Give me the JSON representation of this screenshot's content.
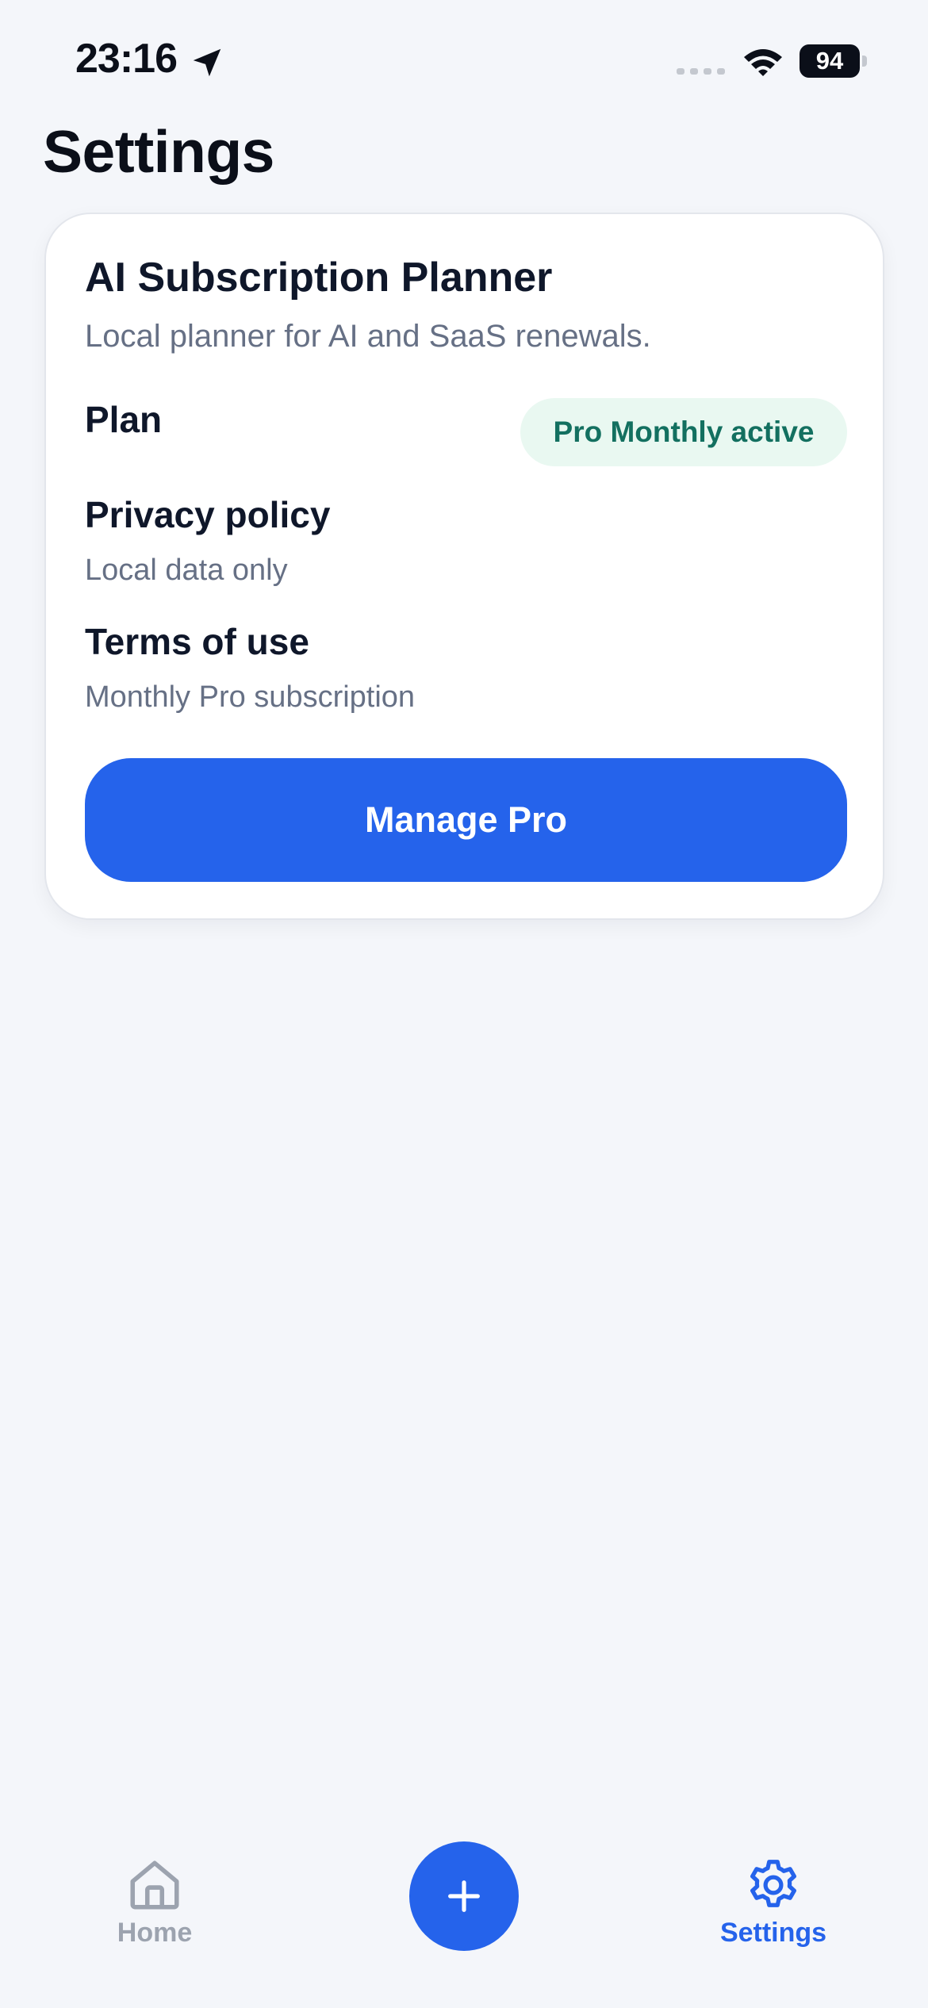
{
  "status_bar": {
    "time": "23:16",
    "battery": "94",
    "icons": [
      "location-arrow-icon",
      "cellular-signal-icon",
      "wifi-icon",
      "battery-icon"
    ]
  },
  "page": {
    "title": "Settings"
  },
  "card": {
    "app_name": "AI Subscription Planner",
    "tagline": "Local planner for AI and SaaS renewals.",
    "plan": {
      "label": "Plan",
      "badge": "Pro Monthly active"
    },
    "privacy": {
      "label": "Privacy policy",
      "detail": "Local data only"
    },
    "terms": {
      "label": "Terms of use",
      "detail": "Monthly Pro subscription"
    },
    "manage_button": "Manage Pro"
  },
  "tab_bar": {
    "home": {
      "label": "Home",
      "icon": "house-icon"
    },
    "add": {
      "icon": "plus-icon"
    },
    "settings": {
      "label": "Settings",
      "icon": "gear-icon",
      "selected": true
    }
  },
  "colors": {
    "accent": "#2563eb",
    "background": "#f4f6fa",
    "badge_bg": "#e9f8f1",
    "badge_text": "#137060",
    "muted_text": "#667085"
  }
}
